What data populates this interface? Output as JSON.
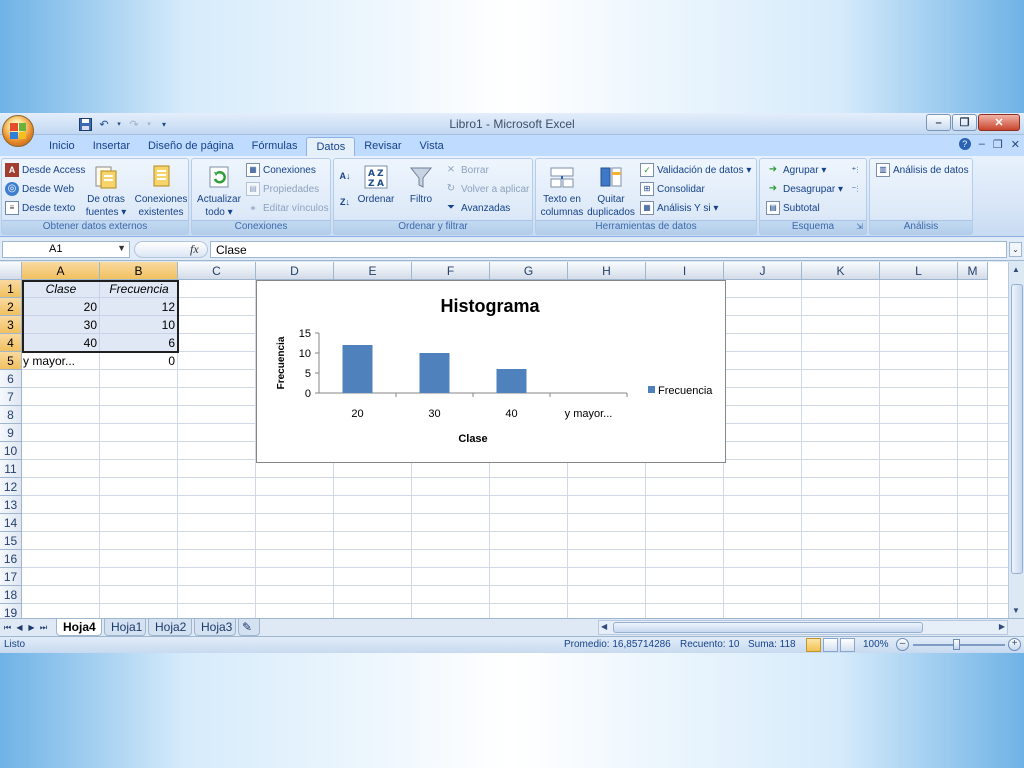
{
  "window": {
    "title": "Libro1 - Microsoft Excel",
    "minimize": "–",
    "restore": "❐",
    "close": "✕"
  },
  "ribbon_tabs": [
    "Inicio",
    "Insertar",
    "Diseño de página",
    "Fórmulas",
    "Datos",
    "Revisar",
    "Vista"
  ],
  "active_tab": "Datos",
  "ribbon": {
    "ext_data": {
      "access": "Desde Access",
      "web": "Desde Web",
      "text": "Desde texto",
      "other_1": "De otras",
      "other_2": "fuentes",
      "conn_1": "Conexiones",
      "conn_2": "existentes",
      "label": "Obtener datos externos"
    },
    "connections": {
      "refresh_1": "Actualizar",
      "refresh_2": "todo",
      "conexiones": "Conexiones",
      "propiedades": "Propiedades",
      "editar": "Editar vínculos",
      "label": "Conexiones"
    },
    "sort": {
      "ordenar": "Ordenar",
      "filtro": "Filtro",
      "borrar": "Borrar",
      "volver": "Volver a aplicar",
      "avanzadas": "Avanzadas",
      "label": "Ordenar y filtrar"
    },
    "tools": {
      "text_cols_1": "Texto en",
      "text_cols_2": "columnas",
      "remove_dup_1": "Quitar",
      "remove_dup_2": "duplicados",
      "validacion": "Validación de datos",
      "consolidar": "Consolidar",
      "analisis_ysi": "Análisis Y si",
      "label": "Herramientas de datos"
    },
    "outline": {
      "agrupar": "Agrupar",
      "desagrupar": "Desagrupar",
      "subtotal": "Subtotal",
      "label": "Esquema"
    },
    "analysis": {
      "analisis_datos": "Análisis de datos",
      "label": "Análisis"
    }
  },
  "formula_bar": {
    "name_box": "A1",
    "fx": "fx",
    "formula": "Clase"
  },
  "columns": [
    "A",
    "B",
    "C",
    "D",
    "E",
    "F",
    "G",
    "H",
    "I",
    "J",
    "K",
    "L",
    "M"
  ],
  "rows": [
    "1",
    "2",
    "3",
    "4",
    "5",
    "6",
    "7",
    "8",
    "9",
    "10",
    "11",
    "12",
    "13",
    "14",
    "15",
    "16",
    "17",
    "18",
    "19"
  ],
  "table": {
    "header": [
      "Clase",
      "Frecuencia"
    ],
    "rows": [
      [
        "20",
        "12"
      ],
      [
        "30",
        "10"
      ],
      [
        "40",
        "6"
      ],
      [
        "y mayor...",
        "0"
      ]
    ]
  },
  "chart_data": {
    "type": "bar",
    "title": "Histograma",
    "xlabel": "Clase",
    "ylabel": "Frecuencia",
    "categories": [
      "20",
      "30",
      "40",
      "y mayor..."
    ],
    "series": [
      {
        "name": "Frecuencia",
        "values": [
          12,
          10,
          6,
          0
        ],
        "color": "#4f81bd"
      }
    ],
    "ylim": [
      0,
      15
    ],
    "yticks": [
      "0",
      "5",
      "10",
      "15"
    ],
    "legend": "right",
    "grid": false
  },
  "sheets": [
    "Hoja4",
    "Hoja1",
    "Hoja2",
    "Hoja3"
  ],
  "active_sheet": "Hoja4",
  "status": {
    "mode": "Listo",
    "average": "Promedio: 16,85714286",
    "count": "Recuento: 10",
    "sum": "Suma: 118",
    "zoom": "100%"
  }
}
